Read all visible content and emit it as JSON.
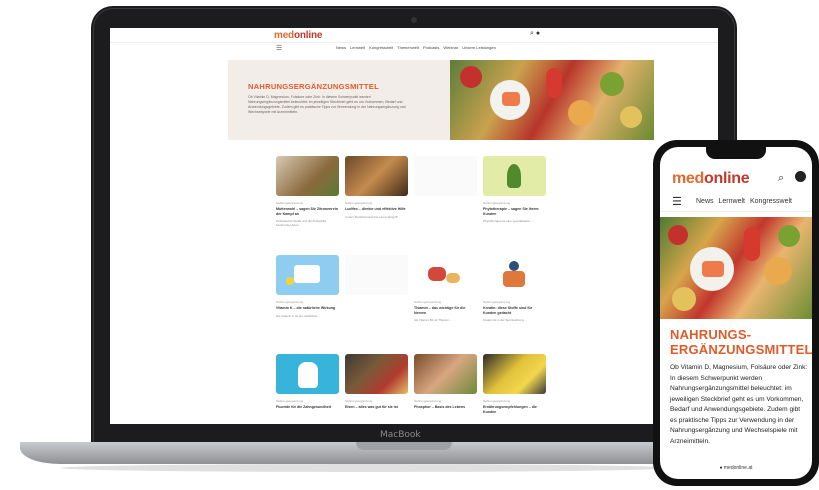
{
  "colors": {
    "brand_orange": "#e06a2f",
    "brand_red": "#c0392b",
    "title_orange": "#e05b2a"
  },
  "laptop": {
    "brand": "MacBook"
  },
  "desktop": {
    "logo": {
      "a": "med",
      "b": "online"
    },
    "nav": [
      "News",
      "Lernwelt",
      "Kongresswelt",
      "Themenwelt",
      "Podcasts",
      "Webinar",
      "Unsere Leistungen"
    ],
    "hero": {
      "title": "NAHRUNGSERGÄNZUNGSMITTEL",
      "text": "Ob Vitamin D, Magnesium, Folsäure oder Zink: In diesem Schwerpunkt werden Nahrungsergänzungsmittel beleuchtet: im jeweiligen Steckbrief geht es um Vorkommen, Bedarf und Anwendungsgebiete. Zudem gibt es praktische Tipps zur Verwendung in der Nahrungsergänzung und Wechselspiele mit Arzneimitteln."
    },
    "cards": [
      {
        "tag": "Nahrungsergänzung",
        "title": "Mutterwohl – sagen Sie Zitronenrein der Kampf an",
        "text": "Probiotische Stoffe und die Probiotika bestimmter Arten ...",
        "icon": "herbs-image"
      },
      {
        "tag": "Nahrungsergänzung",
        "title": "Ludifex – direkte und effektive Hilfe",
        "text": "In der Überlebenszeit bei einem Eingriff ...",
        "icon": "cookies-image"
      },
      {
        "tag": "",
        "title": "",
        "text": "",
        "icon": "empty-image"
      },
      {
        "tag": "Nahrungsergänzung",
        "title": "Phytotherapie – sagen Sie Ihrem Kunden",
        "text": "Phytotherapie ist eine spezialisierte ...",
        "icon": "leaf-image"
      },
      {
        "tag": "Nahrungsergänzung",
        "title": "Vitamin K – die natürliche Wirkung",
        "text": "Die Vitamin K ist ein natürlicher ...",
        "icon": "pills-image"
      },
      {
        "tag": "",
        "title": "",
        "text": "",
        "icon": "empty-image"
      },
      {
        "tag": "Nahrungsergänzung",
        "title": "Thiamin – das wichtige für die Nerven",
        "text": "Als Vitamin B1 ist Thiamin ...",
        "icon": "meat-image"
      },
      {
        "tag": "Nahrungsergänzung",
        "title": "Kreatin: diese Stoffe sind für Kunden gedacht",
        "text": "Kreatin ist in der Sportnahrung ...",
        "icon": "athlete-image"
      },
      {
        "tag": "Nahrungsergänzung",
        "title": "Fluoride für die Zahngesundheit",
        "text": "",
        "icon": "tooth-image"
      },
      {
        "tag": "Nahrungsergänzung",
        "title": "Eisen – alles was gut für sie ist",
        "text": "",
        "icon": "foodbox-image"
      },
      {
        "tag": "Nahrungsergänzung",
        "title": "Phosphor – Basis des Lebens",
        "text": "",
        "icon": "plate-image"
      },
      {
        "tag": "Nahrungsergänzung",
        "title": "Ernährungsempfehlungen – die Kunden",
        "text": "",
        "icon": "banana-image"
      }
    ]
  },
  "phone": {
    "logo": {
      "a": "med",
      "b": "online"
    },
    "nav": [
      "News",
      "Lernwelt",
      "Kongresswelt"
    ],
    "title": "NAHRUNGS-ERGÄNZUNGSMITTEL",
    "text": "Ob Vitamin D, Magnesium, Folsäure oder Zink: In diesem Schwerpunkt werden Nahrungsergänzungsmittel beleuchtet: im jeweiligen Steckbrief geht es um Vorkommen, Bedarf und Anwendungsgebiete. Zudem gibt es praktische Tipps zur Verwendung in der Nahrungsergänzung und Wechselspiele mit Arzneimitteln.",
    "url": "● medonline.at"
  }
}
